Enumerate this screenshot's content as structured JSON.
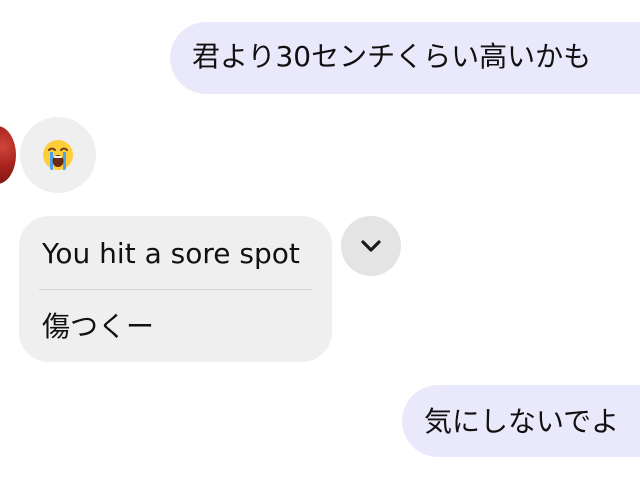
{
  "messages": [
    {
      "direction": "outgoing",
      "text": "君より30センチくらい高いかも"
    },
    {
      "direction": "incoming",
      "type": "emoji",
      "icon": "loudly-crying-face-icon"
    },
    {
      "direction": "incoming",
      "type": "translation",
      "original": "You hit a sore spot",
      "translated": "傷つくー",
      "expand_icon": "chevron-down-icon"
    },
    {
      "direction": "outgoing",
      "text": "気にしないでよ"
    }
  ],
  "colors": {
    "outgoing_bubble": "#eae9fb",
    "incoming_bubble": "#efefef",
    "expand_button": "#e4e4e4",
    "text": "#111111"
  }
}
